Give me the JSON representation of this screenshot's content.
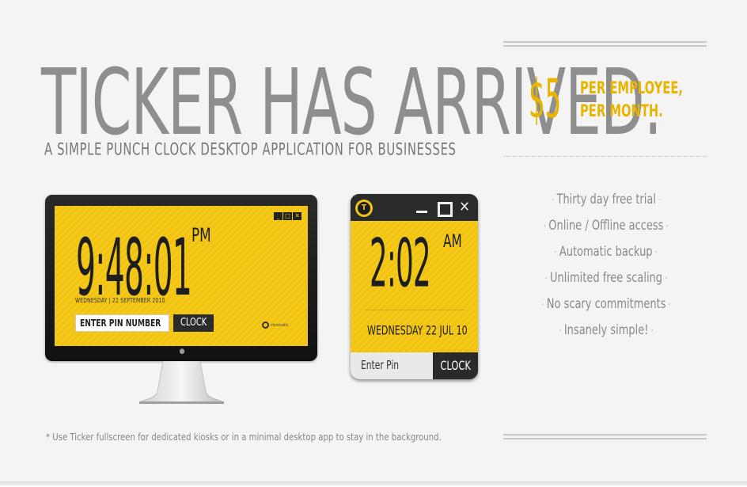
{
  "headline": "TICKER HAS ARRIVED.",
  "subtitle": "A SIMPLE PUNCH CLOCK DESKTOP APPLICATION FOR BUSINESSES",
  "pricing": {
    "amount": "$5",
    "line1": "PER EMPLOYEE,",
    "line2": "PER MONTH."
  },
  "features": [
    "Thirty day free trial",
    "Online / Offline access",
    "Automatic backup",
    "Unlimited free scaling",
    "No scary commitments",
    "Insanely simple!"
  ],
  "footnote": "* Use Ticker fullscreen for dedicated kiosks or in a minimal desktop app to stay in the background.",
  "fullscreen_app": {
    "time": "9:48:01",
    "ampm": "PM",
    "date": "WEDNESDAY | 22 SEPTEMBER 2010",
    "pin_placeholder": "ENTER PIN NUMBER",
    "clock_label": "CLOCK",
    "brand": "chromatic"
  },
  "widget_app": {
    "time": "2:02",
    "ampm": "AM",
    "date": "WEDNESDAY  22 JUL 10",
    "pin_placeholder": "Enter Pin",
    "clock_label": "CLOCK"
  },
  "colors": {
    "accent": "#e8b400",
    "screen_yellow": "#f4c91b",
    "dark": "#2a2a2a",
    "headline_gray": "#8e8e8e"
  },
  "icons": {
    "ticker_logo": "ticker-logo-icon",
    "minimize": "minimize-icon",
    "maximize": "maximize-icon",
    "close": "close-icon",
    "apple": "apple-icon"
  }
}
